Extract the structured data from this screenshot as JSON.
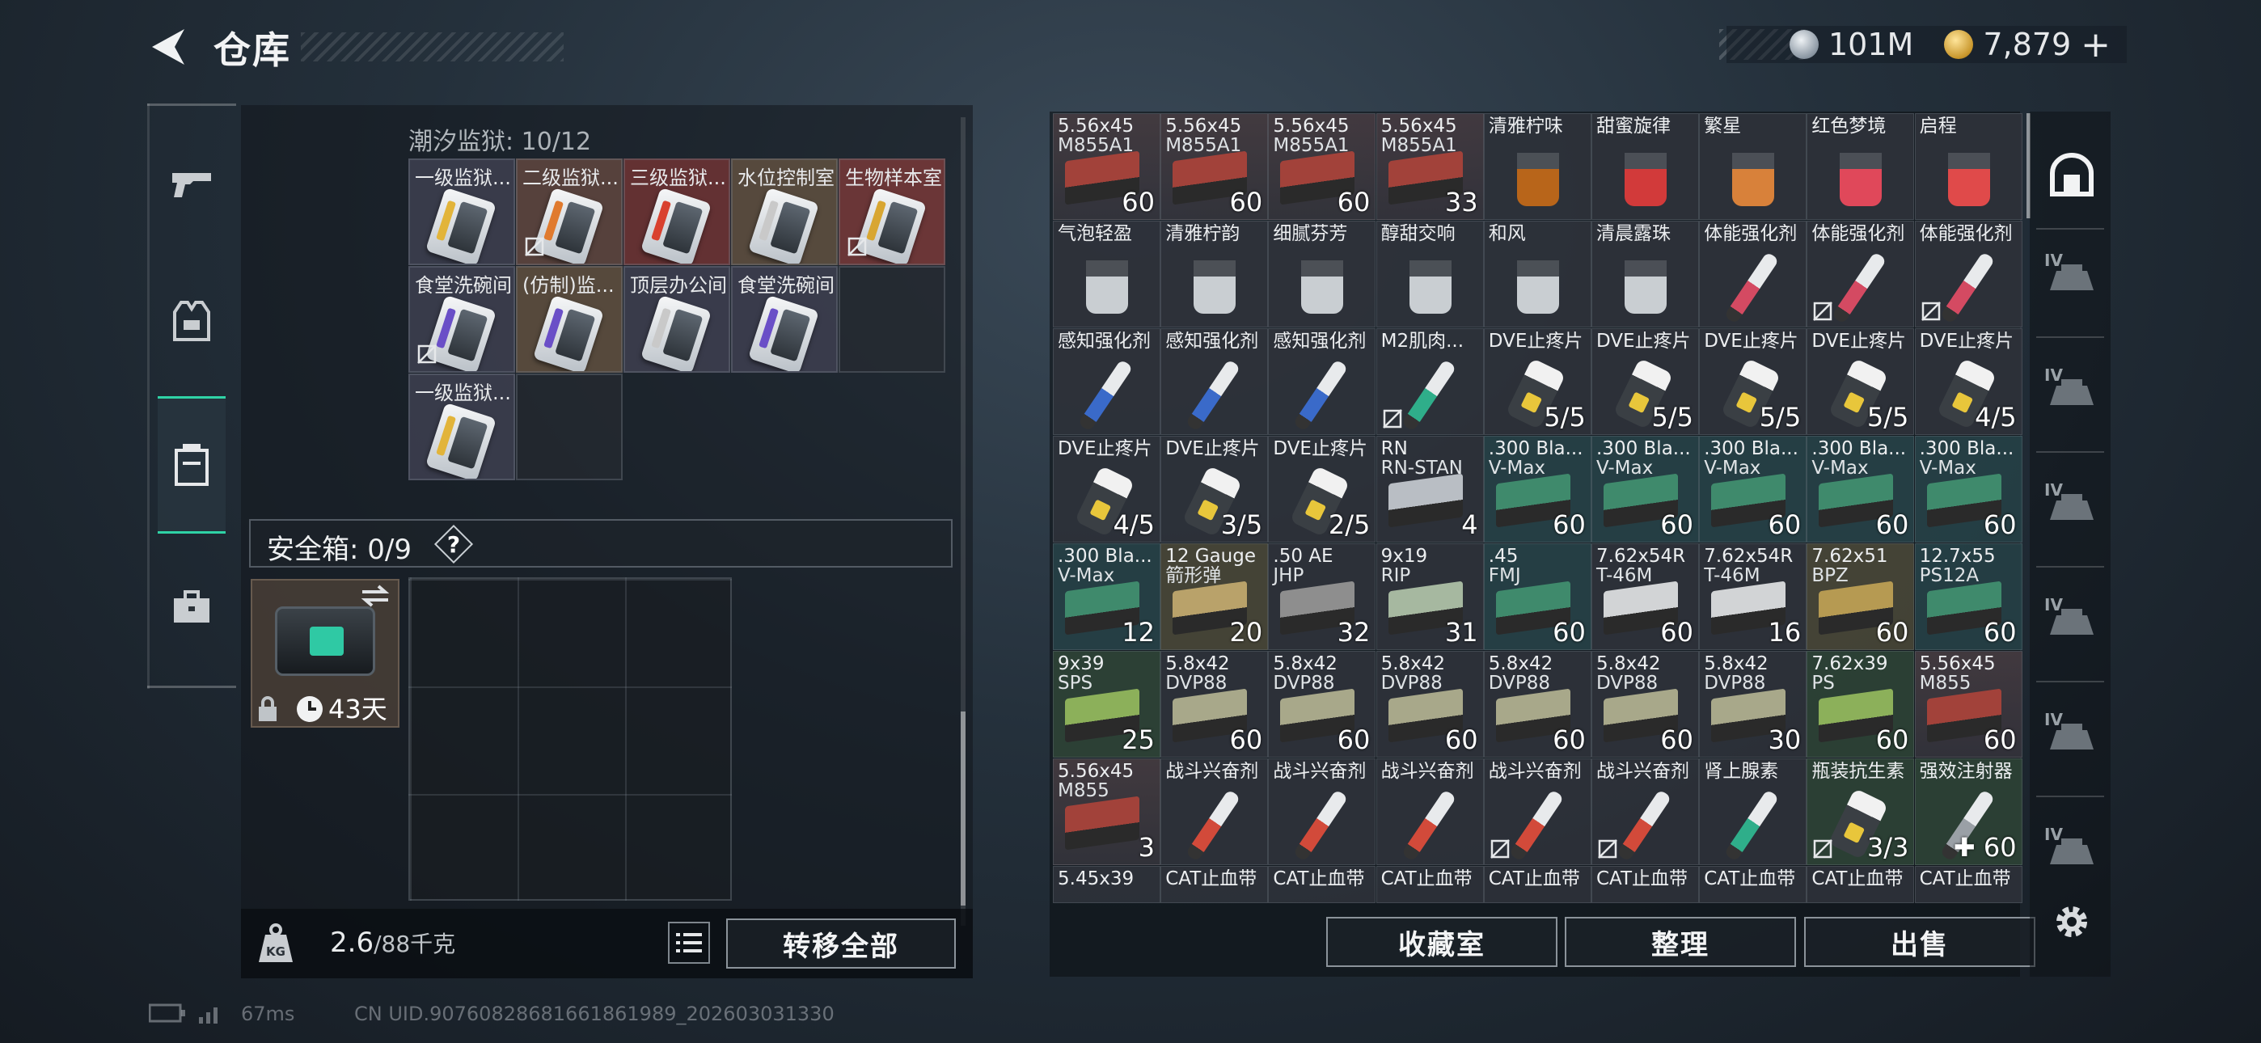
{
  "header": {
    "title": "仓库"
  },
  "currency": {
    "silver": "101M",
    "gold": "7,879",
    "add": "+"
  },
  "left": {
    "section_title": "潮汐监狱: 10/12",
    "keycards": [
      {
        "label": "一级监狱...",
        "stripe": "#e2b43a",
        "bg": "rgba(62,64,80,0.85)",
        "nobind": false
      },
      {
        "label": "二级监狱...",
        "stripe": "#e07a2e",
        "bg": "rgba(96,70,64,0.85)",
        "nobind": true
      },
      {
        "label": "三级监狱...",
        "stripe": "#d9412f",
        "bg": "rgba(112,52,52,0.85)",
        "nobind": false
      },
      {
        "label": "水位控制室",
        "stripe": "#c9c9c9",
        "bg": "rgba(96,80,64,0.85)",
        "nobind": false
      },
      {
        "label": "生物样本室",
        "stripe": "#d8a632",
        "bg": "rgba(120,56,56,0.85)",
        "nobind": true
      },
      {
        "label": "食堂洗碗间",
        "stripe": "#6a4fc7",
        "bg": "rgba(62,64,80,0.85)",
        "nobind": true
      },
      {
        "label": "(仿制)监...",
        "stripe": "#6a4fc7",
        "bg": "rgba(96,80,64,0.85)",
        "nobind": false
      },
      {
        "label": "顶层办公间",
        "stripe": "#c9c9c9",
        "bg": "rgba(62,64,80,0.85)",
        "nobind": false
      },
      {
        "label": "食堂洗碗间",
        "stripe": "#6a4fc7",
        "bg": "rgba(62,64,80,0.85)",
        "nobind": false
      },
      {
        "label": "",
        "stripe": "",
        "bg": "rgba(40,44,50,0.6)",
        "nobind": false
      },
      {
        "label": "一级监狱...",
        "stripe": "#e2b43a",
        "bg": "rgba(62,64,80,0.85)",
        "nobind": false
      },
      {
        "label": "",
        "stripe": "",
        "bg": "rgba(40,44,50,0.6)",
        "nobind": false
      }
    ],
    "safe_title": "安全箱: 0/9",
    "safe_help": "?",
    "case_days": "43天",
    "weight_current": "2.6",
    "weight_max": "/88千克",
    "transfer_all": "转移全部"
  },
  "grid": [
    {
      "n": "5.56x45",
      "n2": "M855A1",
      "q": "60",
      "bg": "bg-red",
      "i": "ammo",
      "c": "#a2423a"
    },
    {
      "n": "5.56x45",
      "n2": "M855A1",
      "q": "60",
      "bg": "bg-red",
      "i": "ammo",
      "c": "#a2423a"
    },
    {
      "n": "5.56x45",
      "n2": "M855A1",
      "q": "60",
      "bg": "bg-red",
      "i": "ammo",
      "c": "#a2423a"
    },
    {
      "n": "5.56x45",
      "n2": "M855A1",
      "q": "33",
      "bg": "bg-red",
      "i": "ammo",
      "c": "#a2423a"
    },
    {
      "n": "清雅柠味",
      "n2": "",
      "q": "",
      "bg": "bg-gray",
      "i": "drink",
      "c": "#b8651a"
    },
    {
      "n": "甜蜜旋律",
      "n2": "",
      "q": "",
      "bg": "bg-gray",
      "i": "drink",
      "c": "#d23a3a"
    },
    {
      "n": "繁星",
      "n2": "",
      "q": "",
      "bg": "bg-gray",
      "i": "drink",
      "c": "#d8813a"
    },
    {
      "n": "红色梦境",
      "n2": "",
      "q": "",
      "bg": "bg-gray",
      "i": "drink",
      "c": "#e0485a"
    },
    {
      "n": "启程",
      "n2": "",
      "q": "",
      "bg": "bg-gray",
      "i": "drink",
      "c": "#e04a4a"
    },
    {
      "n": "气泡轻盈",
      "n2": "",
      "q": "",
      "bg": "bg-gray",
      "i": "drink",
      "c": "#c9ced2"
    },
    {
      "n": "清雅柠韵",
      "n2": "",
      "q": "",
      "bg": "bg-gray",
      "i": "drink",
      "c": "#c9ced2"
    },
    {
      "n": "细腻芬芳",
      "n2": "",
      "q": "",
      "bg": "bg-gray",
      "i": "drink",
      "c": "#c9ced2"
    },
    {
      "n": "醇甜交响",
      "n2": "",
      "q": "",
      "bg": "bg-gray",
      "i": "drink",
      "c": "#c9ced2"
    },
    {
      "n": "和风",
      "n2": "",
      "q": "",
      "bg": "bg-gray",
      "i": "drink",
      "c": "#c9ced2"
    },
    {
      "n": "清晨露珠",
      "n2": "",
      "q": "",
      "bg": "bg-gray",
      "i": "drink",
      "c": "#c9ced2"
    },
    {
      "n": "体能强化剂",
      "n2": "",
      "q": "",
      "bg": "bg-gray",
      "i": "inj",
      "c": "#d44a62"
    },
    {
      "n": "体能强化剂",
      "n2": "",
      "q": "",
      "bg": "bg-gray",
      "i": "inj",
      "c": "#d44a62",
      "lock": true
    },
    {
      "n": "体能强化剂",
      "n2": "",
      "q": "",
      "bg": "bg-gray",
      "i": "inj",
      "c": "#d44a62",
      "lock": true
    },
    {
      "n": "感知强化剂",
      "n2": "",
      "q": "",
      "bg": "bg-gray",
      "i": "inj",
      "c": "#3a6ac9"
    },
    {
      "n": "感知强化剂",
      "n2": "",
      "q": "",
      "bg": "bg-gray",
      "i": "inj",
      "c": "#3a6ac9"
    },
    {
      "n": "感知强化剂",
      "n2": "",
      "q": "",
      "bg": "bg-gray",
      "i": "inj",
      "c": "#3a6ac9"
    },
    {
      "n": "M2肌肉...",
      "n2": "",
      "q": "",
      "bg": "bg-gray",
      "i": "inj",
      "c": "#2fae8a",
      "lock": true
    },
    {
      "n": "DVE止疼片",
      "n2": "",
      "q": "5/5",
      "bg": "bg-gray",
      "i": "pill",
      "c": ""
    },
    {
      "n": "DVE止疼片",
      "n2": "",
      "q": "5/5",
      "bg": "bg-gray",
      "i": "pill",
      "c": ""
    },
    {
      "n": "DVE止疼片",
      "n2": "",
      "q": "5/5",
      "bg": "bg-gray",
      "i": "pill",
      "c": ""
    },
    {
      "n": "DVE止疼片",
      "n2": "",
      "q": "5/5",
      "bg": "bg-gray",
      "i": "pill",
      "c": ""
    },
    {
      "n": "DVE止疼片",
      "n2": "",
      "q": "4/5",
      "bg": "bg-gray",
      "i": "pill",
      "c": ""
    },
    {
      "n": "DVE止疼片",
      "n2": "",
      "q": "4/5",
      "bg": "bg-gray",
      "i": "pill",
      "c": ""
    },
    {
      "n": "DVE止疼片",
      "n2": "",
      "q": "3/5",
      "bg": "bg-gray",
      "i": "pill",
      "c": ""
    },
    {
      "n": "DVE止疼片",
      "n2": "",
      "q": "2/5",
      "bg": "bg-gray",
      "i": "pill",
      "c": ""
    },
    {
      "n": "RN",
      "n2": "RN-STAN",
      "q": "4",
      "bg": "bg-gray",
      "i": "ammo",
      "c": "#b9bec4"
    },
    {
      "n": ".300 Bla...",
      "n2": "V-Max",
      "q": "60",
      "bg": "bg-teal",
      "i": "ammo",
      "c": "#3f8a6c"
    },
    {
      "n": ".300 Bla...",
      "n2": "V-Max",
      "q": "60",
      "bg": "bg-teal",
      "i": "ammo",
      "c": "#3f8a6c"
    },
    {
      "n": ".300 Bla...",
      "n2": "V-Max",
      "q": "60",
      "bg": "bg-teal",
      "i": "ammo",
      "c": "#3f8a6c"
    },
    {
      "n": ".300 Bla...",
      "n2": "V-Max",
      "q": "60",
      "bg": "bg-teal",
      "i": "ammo",
      "c": "#3f8a6c"
    },
    {
      "n": ".300 Bla...",
      "n2": "V-Max",
      "q": "60",
      "bg": "bg-teal",
      "i": "ammo",
      "c": "#3f8a6c"
    },
    {
      "n": ".300 Bla...",
      "n2": "V-Max",
      "q": "12",
      "bg": "bg-teal",
      "i": "ammo",
      "c": "#3f8a6c"
    },
    {
      "n": "12 Gauge",
      "n2": "箭形弹",
      "q": "20",
      "bg": "bg-olive",
      "i": "ammo",
      "c": "#b9a26a"
    },
    {
      "n": ".50 AE",
      "n2": "JHP",
      "q": "32",
      "bg": "bg-gray",
      "i": "ammo",
      "c": "#8e8e8e"
    },
    {
      "n": "9x19",
      "n2": "RIP",
      "q": "31",
      "bg": "bg-gray",
      "i": "ammo",
      "c": "#a6b8a0"
    },
    {
      "n": ".45",
      "n2": "FMJ",
      "q": "60",
      "bg": "bg-teal",
      "i": "ammo",
      "c": "#3f8a6c"
    },
    {
      "n": "7.62x54R",
      "n2": "T-46M",
      "q": "60",
      "bg": "bg-gray",
      "i": "ammo",
      "c": "#d2d4d6"
    },
    {
      "n": "7.62x54R",
      "n2": "T-46M",
      "q": "16",
      "bg": "bg-gray",
      "i": "ammo",
      "c": "#d2d4d6"
    },
    {
      "n": "7.62x51",
      "n2": "BPZ",
      "q": "60",
      "bg": "bg-olive",
      "i": "ammo",
      "c": "#b69a52"
    },
    {
      "n": "12.7x55",
      "n2": "PS12A",
      "q": "60",
      "bg": "bg-teal",
      "i": "ammo",
      "c": "#3f8a6c"
    },
    {
      "n": "9x39",
      "n2": "SPS",
      "q": "25",
      "bg": "bg-green",
      "i": "ammo",
      "c": "#8cb05a"
    },
    {
      "n": "5.8x42",
      "n2": "DVP88",
      "q": "60",
      "bg": "bg-gray",
      "i": "ammo",
      "c": "#a8a88a"
    },
    {
      "n": "5.8x42",
      "n2": "DVP88",
      "q": "60",
      "bg": "bg-gray",
      "i": "ammo",
      "c": "#a8a88a"
    },
    {
      "n": "5.8x42",
      "n2": "DVP88",
      "q": "60",
      "bg": "bg-gray",
      "i": "ammo",
      "c": "#a8a88a"
    },
    {
      "n": "5.8x42",
      "n2": "DVP88",
      "q": "60",
      "bg": "bg-gray",
      "i": "ammo",
      "c": "#a8a88a"
    },
    {
      "n": "5.8x42",
      "n2": "DVP88",
      "q": "60",
      "bg": "bg-gray",
      "i": "ammo",
      "c": "#a8a88a"
    },
    {
      "n": "5.8x42",
      "n2": "DVP88",
      "q": "30",
      "bg": "bg-gray",
      "i": "ammo",
      "c": "#a8a88a"
    },
    {
      "n": "7.62x39",
      "n2": "PS",
      "q": "60",
      "bg": "bg-green",
      "i": "ammo",
      "c": "#8cb05a"
    },
    {
      "n": "5.56x45",
      "n2": "M855",
      "q": "60",
      "bg": "bg-red",
      "i": "ammo",
      "c": "#a2423a"
    },
    {
      "n": "5.56x45",
      "n2": "M855",
      "q": "3",
      "bg": "bg-red",
      "i": "ammo",
      "c": "#a2423a"
    },
    {
      "n": "战斗兴奋剂",
      "n2": "",
      "q": "",
      "bg": "bg-gray",
      "i": "inj",
      "c": "#d24a3a"
    },
    {
      "n": "战斗兴奋剂",
      "n2": "",
      "q": "",
      "bg": "bg-gray",
      "i": "inj",
      "c": "#d24a3a"
    },
    {
      "n": "战斗兴奋剂",
      "n2": "",
      "q": "",
      "bg": "bg-gray",
      "i": "inj",
      "c": "#d24a3a"
    },
    {
      "n": "战斗兴奋剂",
      "n2": "",
      "q": "",
      "bg": "bg-gray",
      "i": "inj",
      "c": "#d24a3a",
      "lock": true
    },
    {
      "n": "战斗兴奋剂",
      "n2": "",
      "q": "",
      "bg": "bg-gray",
      "i": "inj",
      "c": "#d24a3a",
      "lock": true
    },
    {
      "n": "肾上腺素",
      "n2": "",
      "q": "",
      "bg": "bg-gray",
      "i": "inj",
      "c": "#2fae8a"
    },
    {
      "n": "瓶装抗生素",
      "n2": "",
      "q": "3/3",
      "bg": "bg-green",
      "i": "pill",
      "c": "",
      "lock": true
    },
    {
      "n": "强效注射器",
      "n2": "",
      "q": "✚ 60",
      "bg": "bg-green",
      "i": "inj",
      "c": "#9aa0a6"
    },
    {
      "n": "5.45x39",
      "n2": "",
      "q": "",
      "bg": "bg-gray",
      "i": "",
      "c": ""
    },
    {
      "n": "CAT止血带",
      "n2": "",
      "q": "",
      "bg": "bg-gray",
      "i": "",
      "c": ""
    },
    {
      "n": "CAT止血带",
      "n2": "",
      "q": "",
      "bg": "bg-gray",
      "i": "",
      "c": ""
    },
    {
      "n": "CAT止血带",
      "n2": "",
      "q": "",
      "bg": "bg-gray",
      "i": "",
      "c": ""
    },
    {
      "n": "CAT止血带",
      "n2": "",
      "q": "",
      "bg": "bg-gray",
      "i": "",
      "c": ""
    },
    {
      "n": "CAT止血带",
      "n2": "",
      "q": "",
      "bg": "bg-gray",
      "i": "",
      "c": ""
    },
    {
      "n": "CAT止血带",
      "n2": "",
      "q": "",
      "bg": "bg-gray",
      "i": "",
      "c": ""
    },
    {
      "n": "CAT止血带",
      "n2": "",
      "q": "",
      "bg": "bg-gray",
      "i": "",
      "c": ""
    },
    {
      "n": "CAT止血带",
      "n2": "",
      "q": "",
      "bg": "bg-gray",
      "i": "",
      "c": ""
    }
  ],
  "buttons": {
    "collection": "收藏室",
    "sort": "整理",
    "sell": "出售"
  },
  "right_nav_label": "IV",
  "footer": {
    "latency": "67ms",
    "uid": "CN UID.90760828681661861989_202603031330"
  },
  "colors": {
    "accent": "#2fd3a6"
  }
}
